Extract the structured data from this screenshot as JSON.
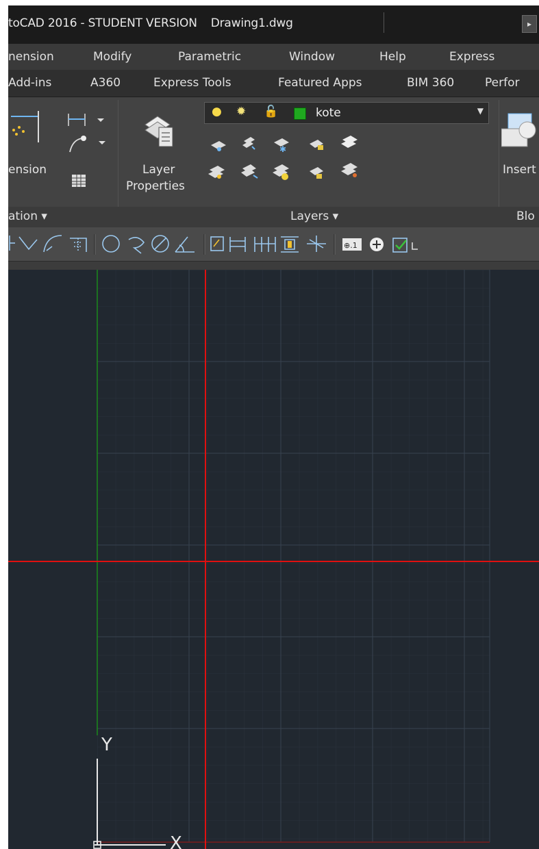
{
  "window": {
    "title": "toCAD 2016 - STUDENT VERSION",
    "document": "Drawing1.dwg",
    "arrow": "▸"
  },
  "menu": {
    "items": [
      "nension",
      "Modify",
      "Parametric",
      "Window",
      "Help",
      "Express"
    ]
  },
  "ribbon_tabs": {
    "items": [
      "Add-ins",
      "A360",
      "Express Tools",
      "Featured Apps",
      "BIM 360",
      "Perfor"
    ]
  },
  "ribbon": {
    "dimension_label": "ension",
    "layer_properties_label": "Layer",
    "layer_properties_label2": "Properties",
    "current_layer": "kote",
    "layer_color": "#1fa81f",
    "insert_label": "Insert",
    "panel_titles": {
      "annotation": "ation ▾",
      "layers": "Layers ▾",
      "block": "Blo"
    }
  },
  "ucs": {
    "y_label": "Y",
    "x_label": "X"
  },
  "colors": {
    "drawing_bg": "#212830",
    "crosshair": "#e01010",
    "y_axis": "#1a8a1a",
    "grid": "#2e3744",
    "grid_major": "#36404e"
  }
}
